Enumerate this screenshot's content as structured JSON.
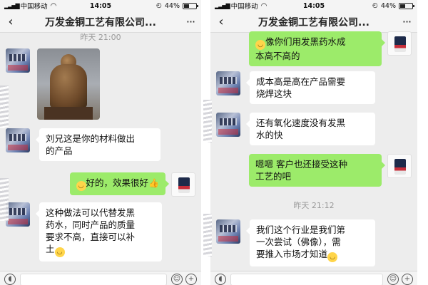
{
  "left": {
    "status": {
      "carrier": "中国移动",
      "time": "14:05",
      "battery": "44%",
      "battery_level": 0.44
    },
    "nav": {
      "back": "‹",
      "title": "万发金铜工艺有限公司...",
      "more": "···"
    },
    "timestamp": "昨天 21:00",
    "messages": [
      {
        "side": "left",
        "type": "image",
        "avatar": "contact-avatar",
        "alt": "bronze statue photo"
      },
      {
        "side": "left",
        "type": "text",
        "avatar": "contact-avatar",
        "lines": [
          "刘兄这是你的材料做出",
          "的产品"
        ]
      },
      {
        "side": "right",
        "type": "text",
        "avatar": "product-avatar",
        "emoji_before": true,
        "text": "好的，效果很好",
        "thumb": "👍"
      },
      {
        "side": "left",
        "type": "text",
        "avatar": "contact-avatar",
        "lines": [
          "这种做法可以代替发黑",
          "药水，同时产品的质量",
          "要求不高，直接可以补",
          "土"
        ],
        "emoji_after": true
      }
    ]
  },
  "right": {
    "status": {
      "carrier": "中国移动",
      "time": "14:05",
      "battery": "44%",
      "battery_level": 0.44
    },
    "nav": {
      "back": "‹",
      "title": "万发金铜工艺有限公司...",
      "more": "···"
    },
    "messages": [
      {
        "side": "right",
        "type": "text",
        "avatar": "product-avatar",
        "emoji_before": true,
        "lines": [
          "像你们用发黑药水成",
          "本高不高的"
        ]
      },
      {
        "side": "left",
        "type": "text",
        "avatar": "contact-avatar",
        "lines": [
          "成本高是高在产品需要",
          "烧焊这块"
        ]
      },
      {
        "side": "left",
        "type": "text",
        "avatar": "contact-avatar",
        "lines": [
          "还有氧化速度没有发黑",
          "水的快"
        ]
      },
      {
        "side": "right",
        "type": "text",
        "avatar": "product-avatar",
        "lines": [
          "嗯嗯 客户也还接受这种",
          "工艺的吧"
        ]
      },
      {
        "side": "left",
        "type": "text",
        "avatar": "contact-avatar",
        "lines": [
          "我们这个行业是我们第",
          "一次尝试（佛像），需",
          "要推入市场才知道"
        ],
        "emoji_after": true
      }
    ],
    "timestamp": "昨天 21:12"
  },
  "colors": {
    "chat_bg": "#ededed",
    "sent_bubble": "#9ceb6a",
    "received_bubble": "#ffffff"
  },
  "icons": {
    "emoji": "smile-emoji",
    "thumb": "thumbs-up-emoji",
    "voice": "voice-icon",
    "plus": "plus-icon"
  }
}
